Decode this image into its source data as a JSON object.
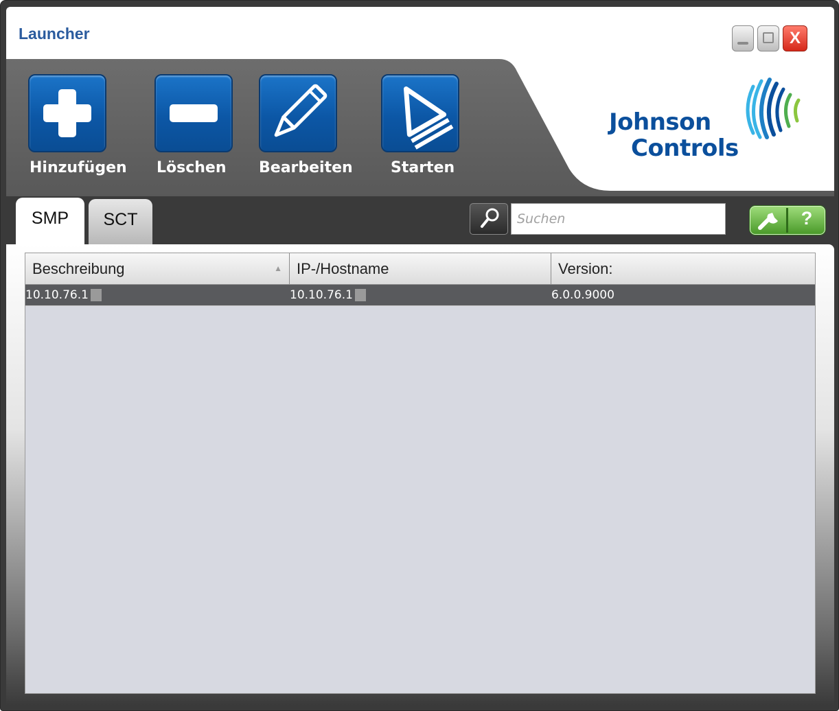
{
  "window": {
    "title": "Launcher"
  },
  "title_buttons": {
    "close_label": "X"
  },
  "toolbar": {
    "add_label": "Hinzufügen",
    "delete_label": "Löschen",
    "edit_label": "Bearbeiten",
    "start_label": "Starten"
  },
  "logo": {
    "line1": "Johnson",
    "line2": "Controls"
  },
  "tabs": [
    {
      "label": "SMP",
      "active": true
    },
    {
      "label": "SCT",
      "active": false
    }
  ],
  "search": {
    "placeholder": "Suchen"
  },
  "tools": {
    "help_label": "?"
  },
  "table": {
    "columns": [
      "Beschreibung",
      "IP-/Hostname",
      "Version:"
    ],
    "sort_indicator": "▲",
    "rows": [
      {
        "description": "10.10.76.1",
        "host": "10.10.76.1",
        "version": "6.0.0.9000"
      }
    ]
  },
  "colors": {
    "title": "#2a5b9e",
    "toolbar_button": "#0c57a6",
    "header_bg": "#5f5f5f",
    "selected_row": "#595a5d",
    "table_bg": "#d7d9e1",
    "tools_button": "#5aa838",
    "close_button": "#d5281a"
  }
}
